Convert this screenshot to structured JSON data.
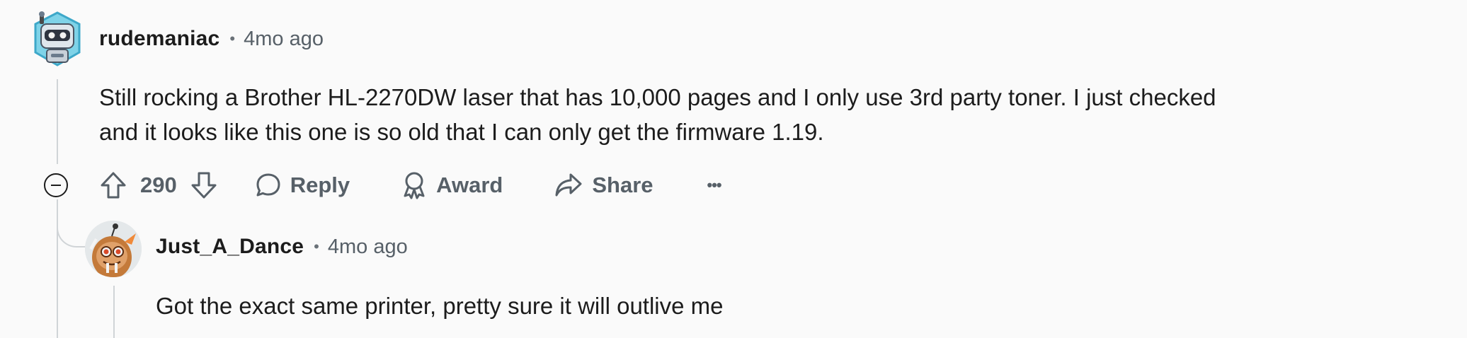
{
  "comments": [
    {
      "username": "rudemaniac",
      "time": "4mo ago",
      "body": [
        "Still rocking a Brother HL-2270DW laser that has 10,000 pages and I only use 3rd party toner. I just checked",
        "and it looks like this one is so old that I can only get the firmware 1.19."
      ],
      "votes": "290",
      "actions": {
        "reply": "Reply",
        "award": "Award",
        "share": "Share",
        "more": "•••"
      }
    },
    {
      "username": "Just_A_Dance",
      "time": "4mo ago",
      "body": [
        "Got the exact same printer, pretty sure it will outlive me"
      ]
    }
  ],
  "separator": "•",
  "icons": {
    "collapse": "collapse-icon",
    "upvote": "upvote-arrow-icon",
    "downvote": "downvote-arrow-icon",
    "reply": "speech-bubble-icon",
    "award": "award-medal-icon",
    "share": "share-arrow-icon",
    "more": "more-dots-icon"
  },
  "colors": {
    "background": "#fafafa",
    "text": "#1c1c1c",
    "muted": "#576068",
    "thread_line": "#d0d4d7"
  }
}
